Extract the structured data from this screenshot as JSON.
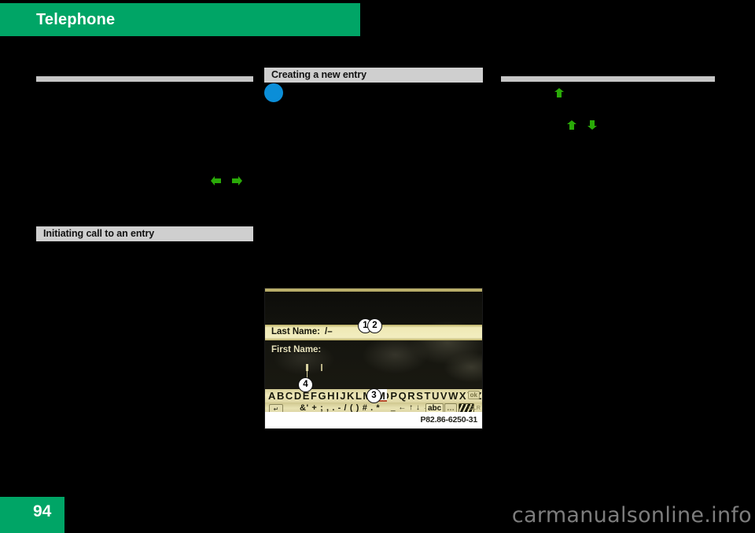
{
  "document": {
    "chapter_title": "Telephone",
    "page_number": "94",
    "watermark": "carmanualsonline.info"
  },
  "headings": {
    "creating_entry": "Creating a new entry",
    "initiating_call": "Initiating call to an entry"
  },
  "figure": {
    "caption": "P82.86-6250-31",
    "last_name_label": "Last Name:",
    "last_name_value": "/–",
    "first_name_label": "First Name:",
    "alphabet_row": "ABCDEFGHIJKLMNOPQRSTUVWXYZ…",
    "selected_letter": "M",
    "ok_key": "ok",
    "back_key": "↵",
    "punctuation_row": "&' + ; , . - / ( ) # . *",
    "arrow_row": "_ ← ↑ ↓ →",
    "abc_key": "abc",
    "dots_key": "…",
    "clr_key": "CLR",
    "callouts": {
      "one": "1",
      "two": "2",
      "three": "3",
      "four": "4"
    }
  },
  "colors": {
    "brand_green": "#00a566",
    "heading_gray": "#cfcfcf",
    "rule_gray": "#c6c6c6",
    "bullet_blue": "#0b8ed8",
    "marker_green": "#2aaa08"
  }
}
